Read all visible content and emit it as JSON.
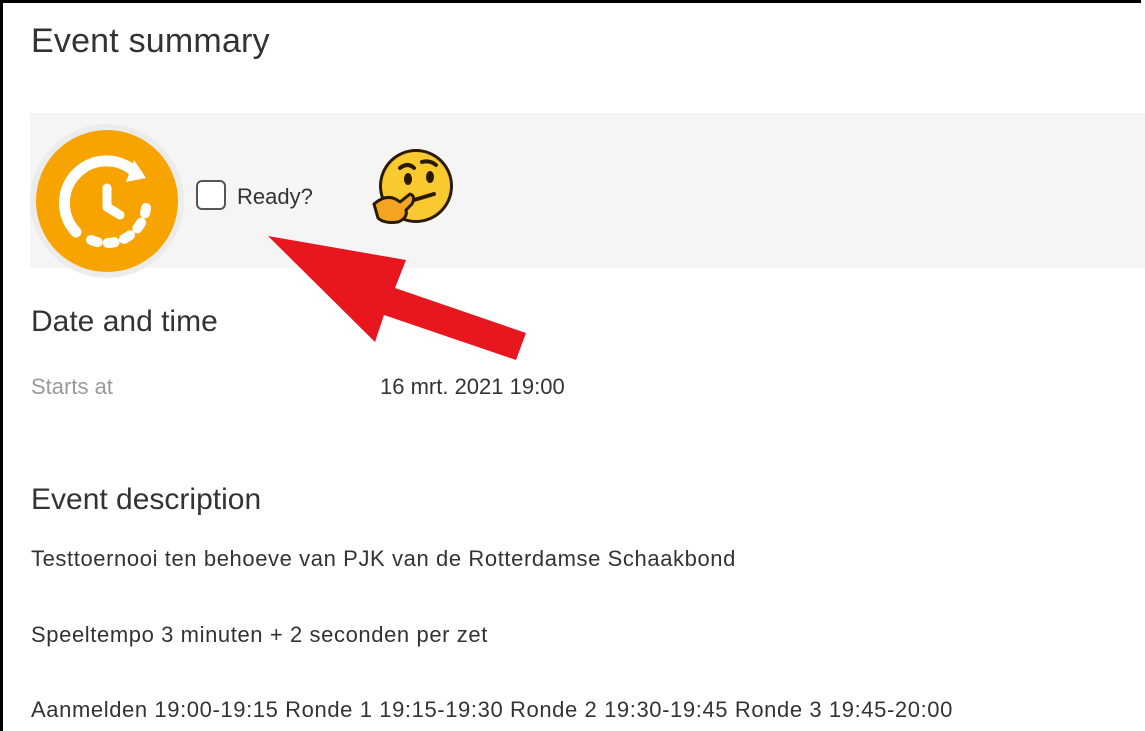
{
  "summary": {
    "title": "Event summary",
    "ready_label": "Ready?",
    "ready_checked": false,
    "status_icon": "clock-progress-icon",
    "reaction_icon": "thinking-face-emoji",
    "colors": {
      "status_orange": "#f7a400",
      "arrow_red": "#e8161f",
      "panel_gray": "#f5f5f5"
    }
  },
  "date_time": {
    "heading": "Date and time",
    "starts_label": "Starts at",
    "starts_value": "16 mrt. 2021 19:00"
  },
  "description": {
    "heading": "Event description",
    "lines": [
      "Testtoernooi ten behoeve van PJK van de Rotterdamse Schaakbond",
      "Speeltempo 3 minuten + 2 seconden per zet",
      "Aanmelden 19:00-19:15 Ronde 1 19:15-19:30 Ronde 2 19:30-19:45 Ronde 3 19:45-20:00"
    ]
  }
}
